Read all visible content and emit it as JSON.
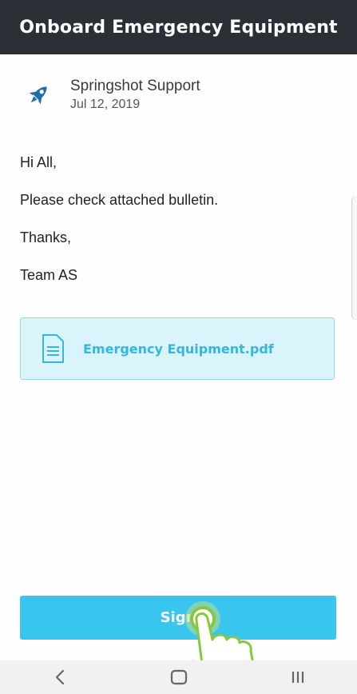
{
  "header": {
    "title": "Onboard Emergency Equipment"
  },
  "message": {
    "sender_name": "Springshot Support",
    "date": "Jul 12, 2019",
    "sender_icon": "rocket-icon",
    "body_lines": [
      "Hi All,",
      "Please check attached bulletin.",
      "Thanks,",
      "Team AS"
    ]
  },
  "attachment": {
    "icon": "document-icon",
    "file_name": "Emergency Equipment.pdf"
  },
  "actions": {
    "sign_label": "Sign"
  },
  "navbar": {
    "back_icon": "back-icon",
    "home_icon": "home-icon",
    "recents_icon": "recents-icon"
  },
  "colors": {
    "header_bg": "#2b2f36",
    "accent": "#38c6ef",
    "attachment_bg": "#d9f4fb",
    "attachment_text": "#35b7dd",
    "rocket": "#1f6fa8"
  }
}
